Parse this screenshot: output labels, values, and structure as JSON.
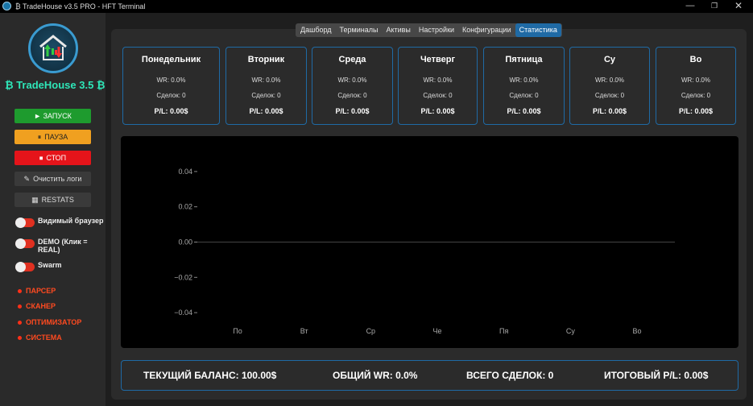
{
  "window": {
    "title": "₿ TradeHouse v3.5 PRO - HFT Terminal",
    "controls": [
      "—",
      "❐",
      "✕"
    ]
  },
  "sidebar": {
    "brand": "₿ TradeHouse 3.5 ₿",
    "buttons": {
      "start": "► ЗАПУСК",
      "pause": "ПАУЗА",
      "stop": "СТОП",
      "clear_logs": "Очистить логи",
      "restats": "RESTATS"
    },
    "toggles": [
      {
        "label": "Видимый браузер",
        "state": "off"
      },
      {
        "label": "DEMO (Клик = REAL)",
        "state": "off"
      },
      {
        "label": "Swarm",
        "state": "off"
      }
    ],
    "sections": [
      "ПАРСЕР",
      "СКАНЕР",
      "ОПТИМИЗАТОР",
      "СИСТЕМА"
    ]
  },
  "tabs": [
    "Дашборд",
    "Терминалы",
    "Активы",
    "Настройки",
    "Конфигурации",
    "Статистика"
  ],
  "active_tab": "Статистика",
  "days": [
    {
      "name": "Понедельник",
      "wr": "WR: 0.0%",
      "deals": "Сделок: 0",
      "pl": "P/L: 0.00$"
    },
    {
      "name": "Вторник",
      "wr": "WR: 0.0%",
      "deals": "Сделок: 0",
      "pl": "P/L: 0.00$"
    },
    {
      "name": "Среда",
      "wr": "WR: 0.0%",
      "deals": "Сделок: 0",
      "pl": "P/L: 0.00$"
    },
    {
      "name": "Четверг",
      "wr": "WR: 0.0%",
      "deals": "Сделок: 0",
      "pl": "P/L: 0.00$"
    },
    {
      "name": "Пятница",
      "wr": "WR: 0.0%",
      "deals": "Сделок: 0",
      "pl": "P/L: 0.00$"
    },
    {
      "name": "Су",
      "wr": "WR: 0.0%",
      "deals": "Сделок: 0",
      "pl": "P/L: 0.00$"
    },
    {
      "name": "Во",
      "wr": "WR: 0.0%",
      "deals": "Сделок: 0",
      "pl": "P/L: 0.00$"
    }
  ],
  "chart_data": {
    "type": "line",
    "categories": [
      "По",
      "Вт",
      "Ср",
      "Че",
      "Пя",
      "Су",
      "Во"
    ],
    "series": [
      {
        "values": [
          0,
          0,
          0,
          0,
          0,
          0,
          0
        ]
      }
    ],
    "yticks": [
      "0.04",
      "0.02",
      "0.00",
      "−0.02",
      "−0.04"
    ],
    "ylim": [
      -0.05,
      0.05
    ],
    "title": "",
    "xlabel": "",
    "ylabel": "",
    "grid": false,
    "background": "#000000",
    "line_color": "#444444"
  },
  "summary": {
    "balance": "ТЕКУЩИЙ БАЛАНС: 100.00$",
    "winrate": "ОБЩИЙ WR: 0.0%",
    "deals": "ВСЕГО СДЕЛОК: 0",
    "pl": "ИТОГОВЫЙ P/L: 0.00$"
  },
  "colors": {
    "accent": "#1f6aa5",
    "brand": "#2ee6b8",
    "start": "#1e9b2e",
    "pause": "#f0a020",
    "stop": "#e5141a",
    "section": "#ff4a20"
  }
}
